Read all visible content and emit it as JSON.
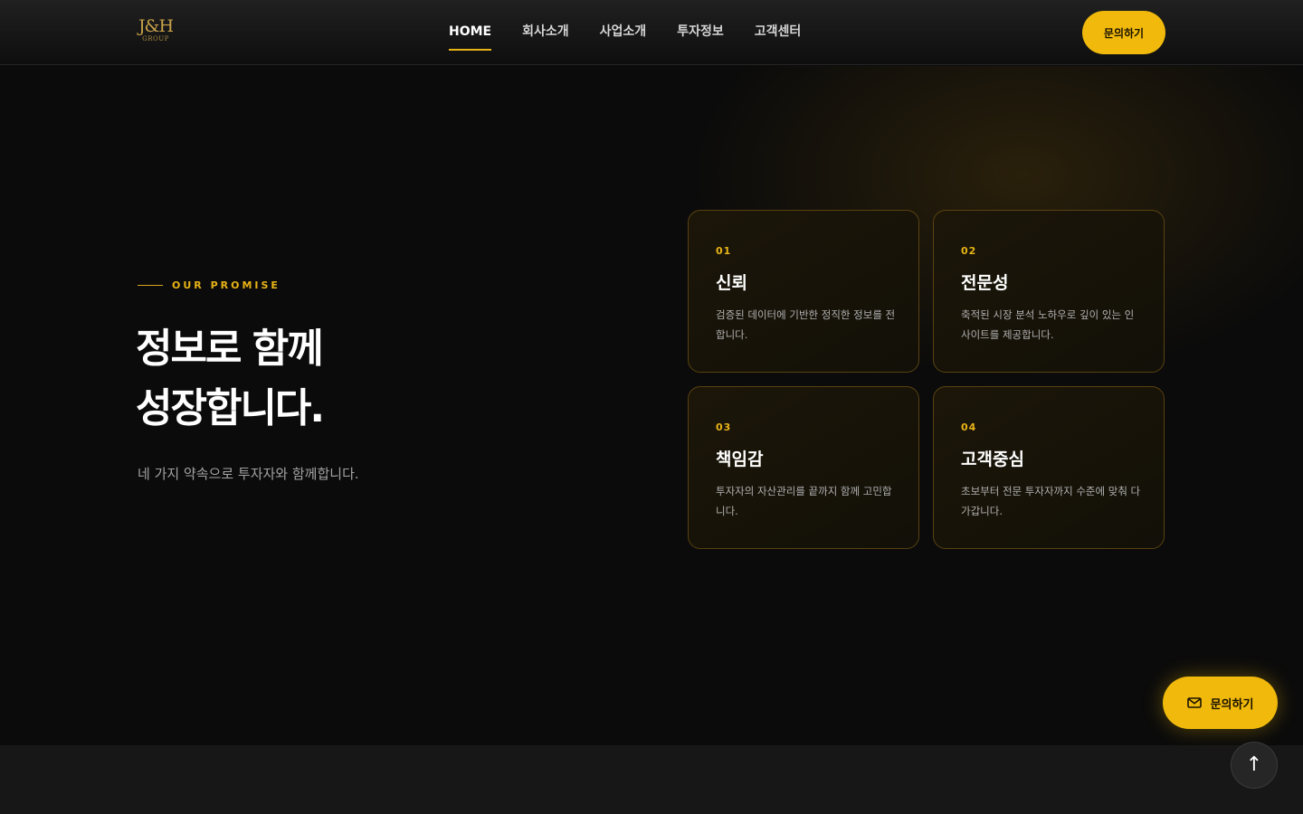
{
  "header": {
    "logo_main": "J&H",
    "logo_sub": "GROUP",
    "nav": [
      {
        "label": "HOME",
        "active": true
      },
      {
        "label": "회사소개",
        "active": false
      },
      {
        "label": "사업소개",
        "active": false
      },
      {
        "label": "투자정보",
        "active": false
      },
      {
        "label": "고객센터",
        "active": false
      }
    ],
    "cta_label": "문의하기"
  },
  "hero": {
    "eyebrow": "OUR PROMISE",
    "headline_line1": "정보로 함께",
    "headline_line2": "성장합니다.",
    "subtext": "네 가지 약속으로 투자자와 함께합니다."
  },
  "cards": [
    {
      "num": "01",
      "title": "신뢰",
      "desc": "검증된 데이터에 기반한 정직한 정보를 전합니다."
    },
    {
      "num": "02",
      "title": "전문성",
      "desc": "축적된 시장 분석 노하우로 깊이 있는 인사이트를 제공합니다."
    },
    {
      "num": "03",
      "title": "책임감",
      "desc": "투자자의 자산관리를 끝까지 함께 고민합니다."
    },
    {
      "num": "04",
      "title": "고객중심",
      "desc": "초보부터 전문 투자자까지 수준에 맞춰 다가갑니다."
    }
  ],
  "floating": {
    "cta_label": "문의하기",
    "cta_icon": "mail-icon",
    "top_icon": "arrow-up-icon",
    "top_glyph": "↑"
  },
  "colors": {
    "accent": "#f0b90b",
    "background": "#0b0b0b"
  }
}
